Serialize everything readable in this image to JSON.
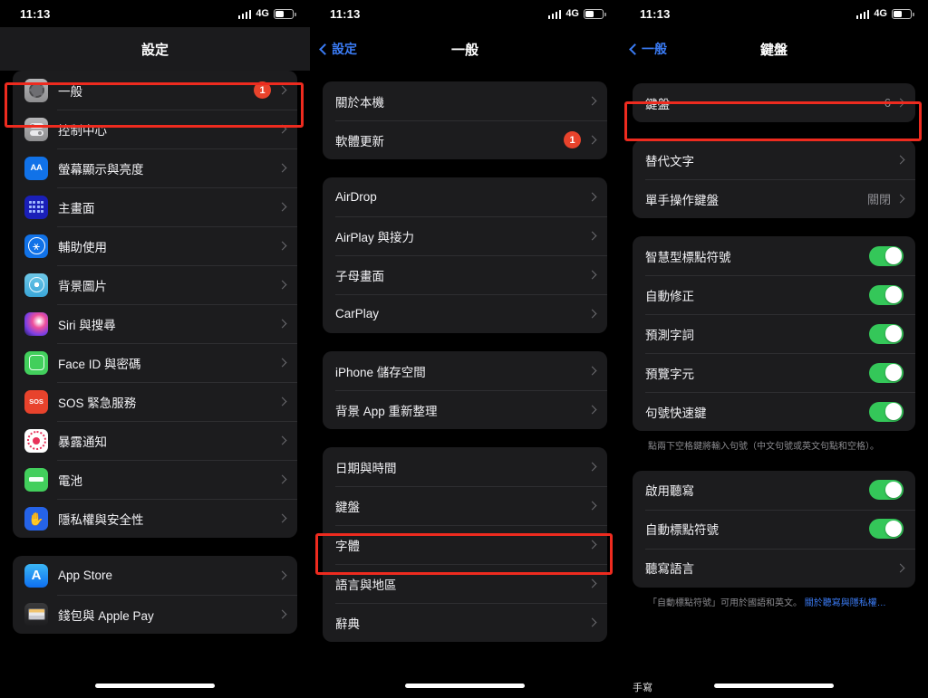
{
  "status_bar": {
    "time": "11:13",
    "network": "4G",
    "signal_icon": "signal-bars-icon",
    "battery_icon": "battery-icon"
  },
  "panel1": {
    "nav": {
      "title": "設定"
    },
    "groups": [
      {
        "rows": [
          {
            "icon": "gear-icon",
            "label": "一般",
            "badge": "1",
            "highlighted": true
          },
          {
            "icon": "control-center-icon",
            "label": "控制中心"
          },
          {
            "icon": "display-brightness-icon",
            "label": "螢幕顯示與亮度"
          },
          {
            "icon": "home-screen-icon",
            "label": "主畫面"
          },
          {
            "icon": "accessibility-icon",
            "label": "輔助使用"
          },
          {
            "icon": "wallpaper-icon",
            "label": "背景圖片"
          },
          {
            "icon": "siri-icon",
            "label": "Siri 與搜尋"
          },
          {
            "icon": "face-id-icon",
            "label": "Face ID 與密碼"
          },
          {
            "icon": "sos-icon",
            "label": "SOS 緊急服務"
          },
          {
            "icon": "exposure-notification-icon",
            "label": "暴露通知"
          },
          {
            "icon": "battery-settings-icon",
            "label": "電池"
          },
          {
            "icon": "privacy-icon",
            "label": "隱私權與安全性"
          }
        ]
      },
      {
        "rows": [
          {
            "icon": "app-store-icon",
            "label": "App Store"
          },
          {
            "icon": "wallet-icon",
            "label": "錢包與 Apple Pay"
          }
        ]
      }
    ]
  },
  "panel2": {
    "nav": {
      "back": "設定",
      "title": "一般"
    },
    "groups": [
      {
        "rows": [
          {
            "label": "關於本機"
          },
          {
            "label": "軟體更新",
            "badge": "1"
          }
        ]
      },
      {
        "rows": [
          {
            "label": "AirDrop"
          },
          {
            "label": "AirPlay 與接力"
          },
          {
            "label": "子母畫面"
          },
          {
            "label": "CarPlay"
          }
        ]
      },
      {
        "rows": [
          {
            "label": "iPhone 儲存空間"
          },
          {
            "label": "背景 App 重新整理"
          }
        ]
      },
      {
        "rows": [
          {
            "label": "日期與時間"
          },
          {
            "label": "鍵盤",
            "highlighted": true
          },
          {
            "label": "字體"
          },
          {
            "label": "語言與地區"
          },
          {
            "label": "辭典"
          }
        ]
      }
    ]
  },
  "panel3": {
    "nav": {
      "back": "一般",
      "title": "鍵盤"
    },
    "groups": [
      {
        "rows": [
          {
            "label": "鍵盤",
            "value": "6",
            "highlighted": true
          }
        ]
      },
      {
        "rows": [
          {
            "label": "替代文字"
          },
          {
            "label": "單手操作鍵盤",
            "value": "關閉"
          }
        ]
      },
      {
        "rows": [
          {
            "label": "智慧型標點符號",
            "toggle": true
          },
          {
            "label": "自動修正",
            "toggle": true
          },
          {
            "label": "預測字詞",
            "toggle": true
          },
          {
            "label": "預覽字元",
            "toggle": true
          },
          {
            "label": "句號快速鍵",
            "toggle": true
          }
        ],
        "footnote": "點兩下空格鍵將輸入句號（中文句號或英文句點和空格）。"
      },
      {
        "rows": [
          {
            "label": "啟用聽寫",
            "toggle": true
          },
          {
            "label": "自動標點符號",
            "toggle": true
          },
          {
            "label": "聽寫語言"
          }
        ],
        "footnote_prefix": "「自動標點符號」可用於國語和英文。 ",
        "footnote_link": "關於聽寫與隱私權…"
      }
    ],
    "handwriting_label": "手寫"
  },
  "colors": {
    "accent_blue": "#3b7cf6",
    "toggle_green": "#34c759",
    "badge_red": "#e8432c",
    "highlight_red": "#ee2b1f",
    "row_bg": "#1c1c1e",
    "page_bg": "#000000"
  }
}
